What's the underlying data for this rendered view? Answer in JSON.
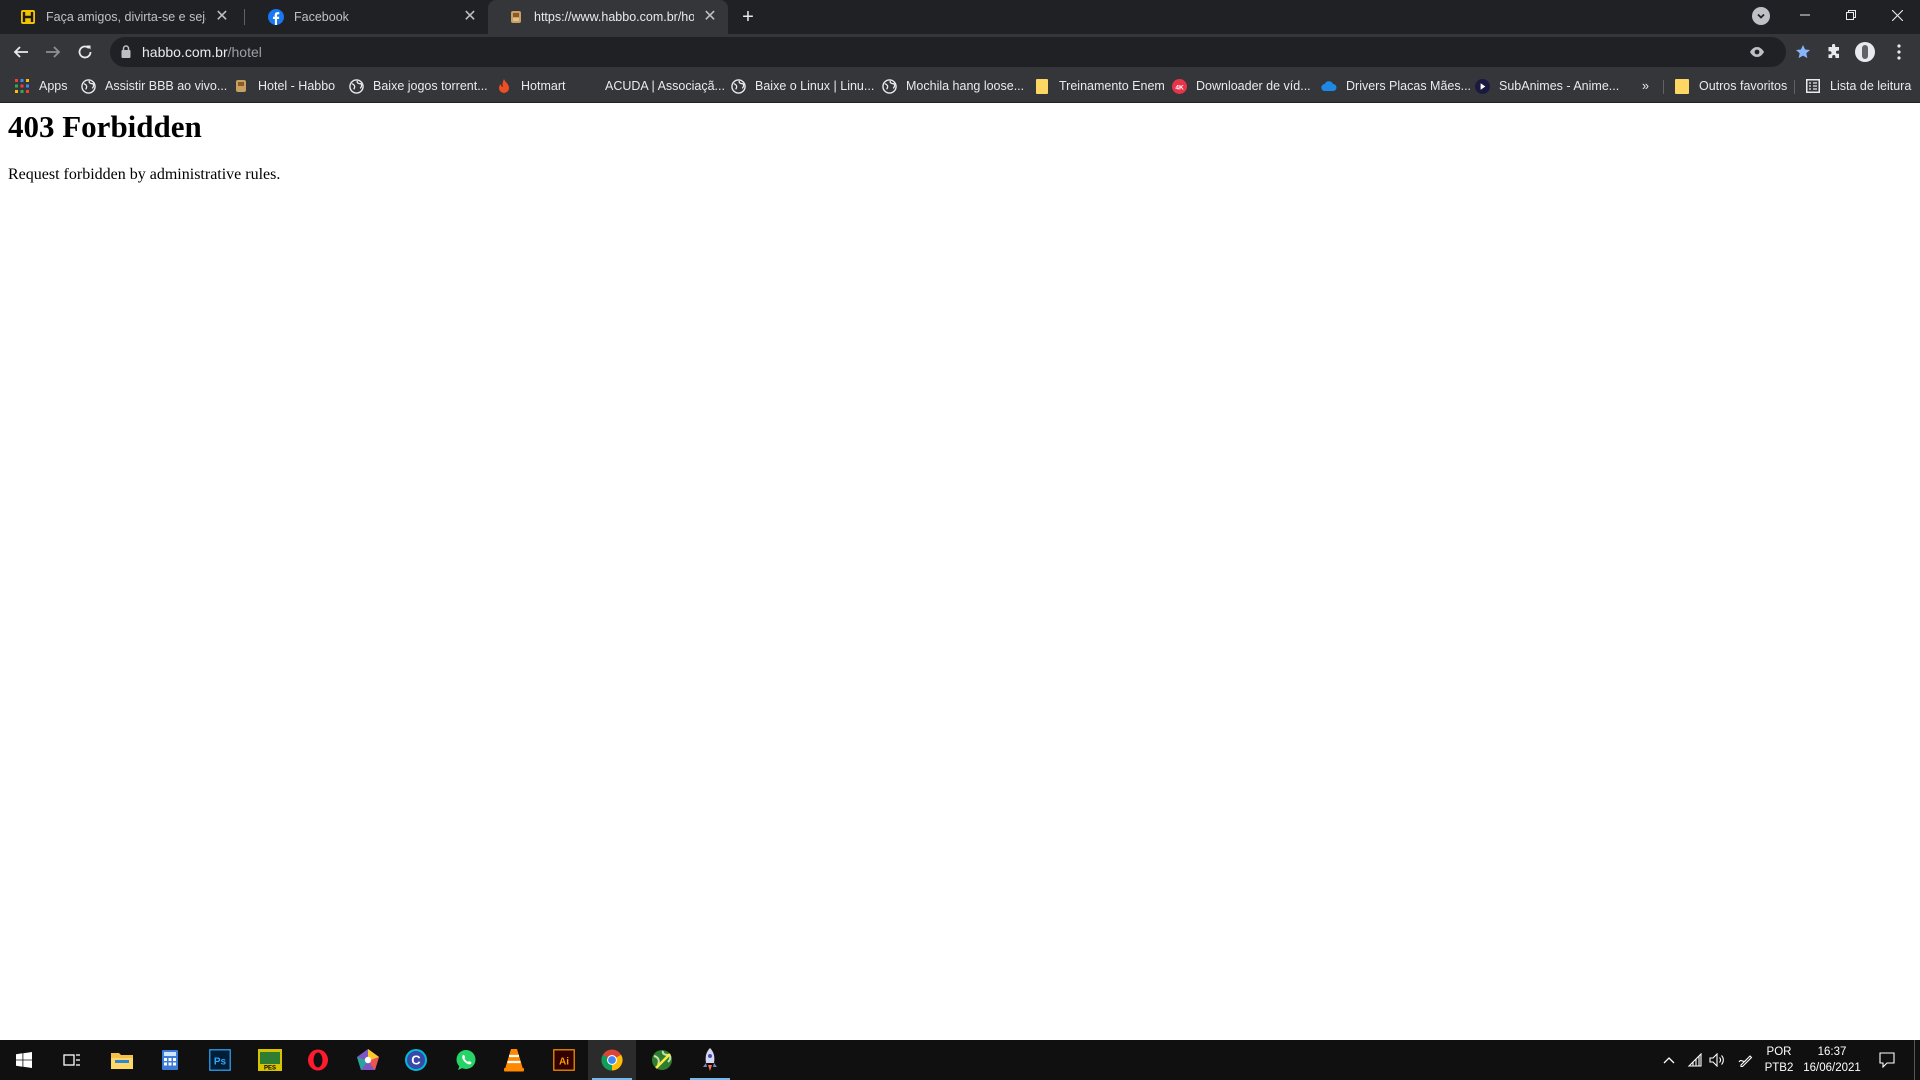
{
  "browser": {
    "tabs": [
      {
        "title": "Faça amigos, divirta-se e seja famoso",
        "active": false
      },
      {
        "title": "Facebook",
        "active": false
      },
      {
        "title": "https://www.habbo.com.br/hotel",
        "active": true
      }
    ],
    "address": {
      "host": "habbo.com.br",
      "path": "/hotel"
    },
    "bookmarks": [
      {
        "label": "Apps",
        "icon": "apps-grid-icon"
      },
      {
        "label": "Assistir BBB ao vivo...",
        "icon": "globe-icon"
      },
      {
        "label": "Hotel - Habbo",
        "icon": "habbo-icon"
      },
      {
        "label": "Baixe jogos torrent...",
        "icon": "globe-icon"
      },
      {
        "label": "Hotmart",
        "icon": "hotmart-flame-icon"
      },
      {
        "label": "ACUDA | Associaçã...",
        "icon": "none"
      },
      {
        "label": "Baixe o Linux | Linu...",
        "icon": "globe-icon"
      },
      {
        "label": "Mochila hang loose...",
        "icon": "globe-icon"
      },
      {
        "label": "Treinamento Enem",
        "icon": "yellow-page-icon"
      },
      {
        "label": "Downloader de víd...",
        "icon": "4k-icon"
      },
      {
        "label": "Drivers Placas Mães...",
        "icon": "cloud-icon"
      },
      {
        "label": "SubAnimes - Anime...",
        "icon": "play-icon"
      }
    ],
    "overflow_label": "»",
    "other_bookmarks": "Outros favoritos",
    "reading_list": "Lista de leitura"
  },
  "page": {
    "heading": "403 Forbidden",
    "message": "Request forbidden by administrative rules."
  },
  "taskbar": {
    "language": "POR",
    "layout": "PTB2",
    "time": "16:37",
    "date": "16/06/2021",
    "pinned": [
      "file-explorer-icon",
      "calculator-icon",
      "photoshop-icon",
      "pes-game-icon",
      "opera-icon",
      "polygon-app-icon",
      "c-app-icon",
      "whatsapp-icon",
      "vlc-icon",
      "illustrator-icon",
      "chrome-icon",
      "globe-app-icon",
      "rocket-app-icon"
    ]
  },
  "colors": {
    "chrome_dark": "#202124",
    "chrome_mid": "#35363a",
    "accent_blue": "#8ab4f8",
    "taskbar": "#101010"
  }
}
